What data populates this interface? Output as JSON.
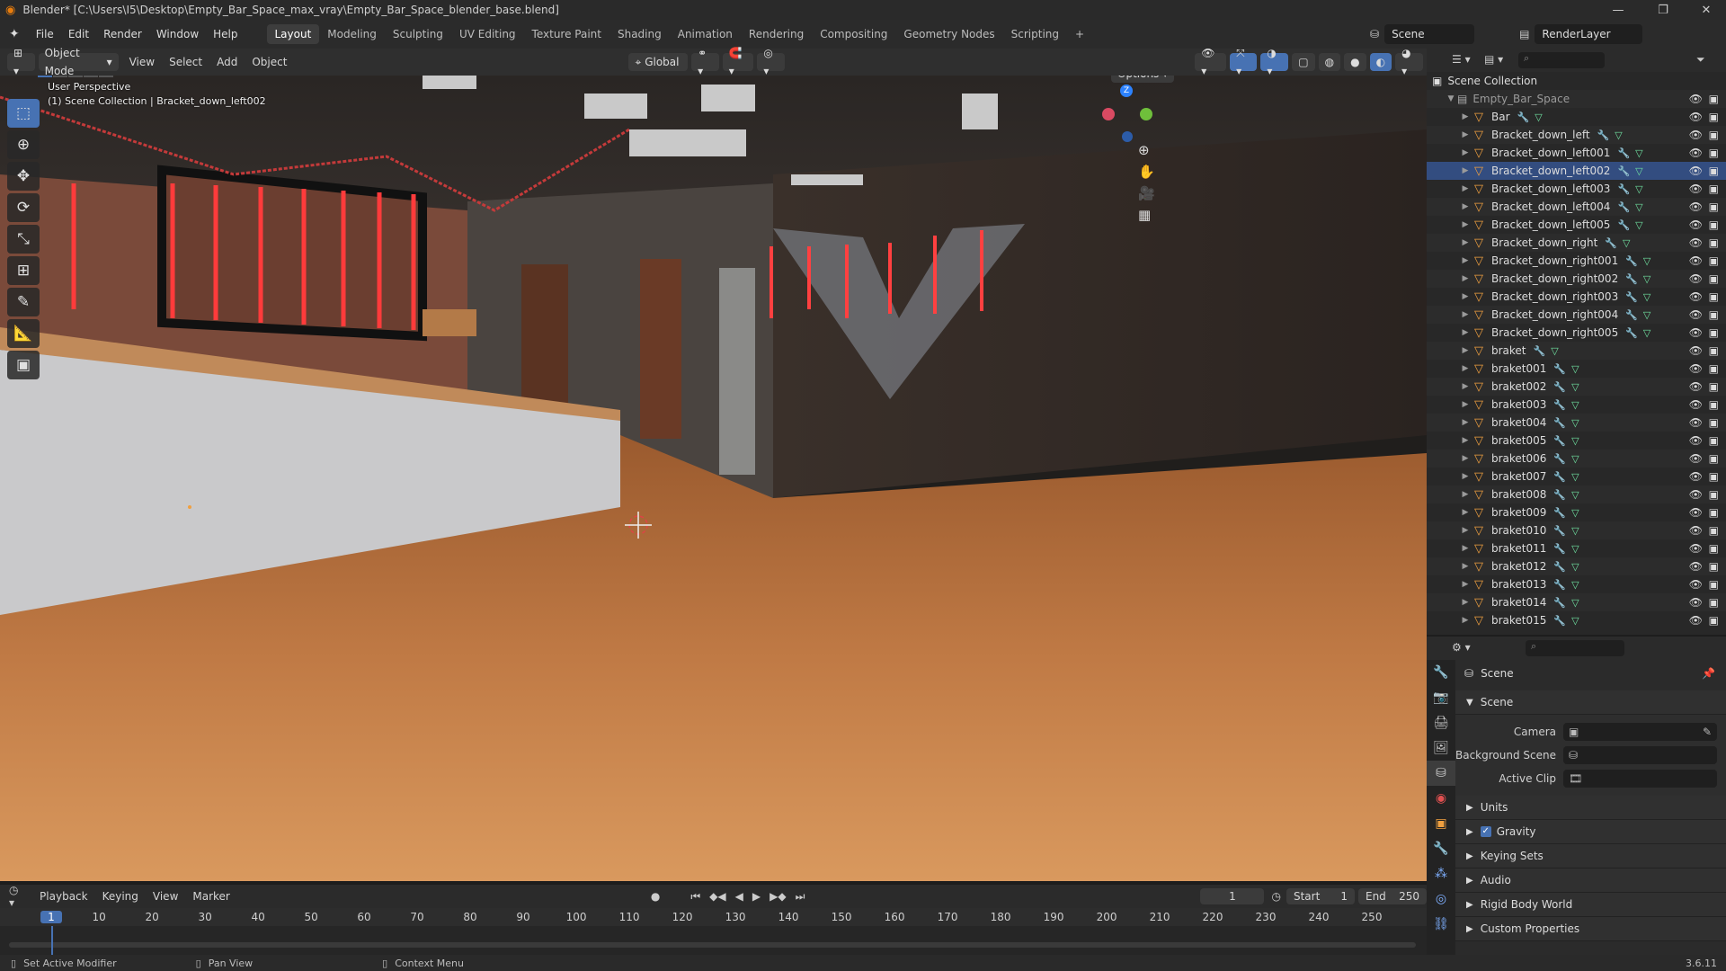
{
  "window": {
    "title": "Blender* [C:\\Users\\I5\\Desktop\\Empty_Bar_Space_max_vray\\Empty_Bar_Space_blender_base.blend]"
  },
  "menus": [
    "File",
    "Edit",
    "Render",
    "Window",
    "Help"
  ],
  "workspaces": [
    "Layout",
    "Modeling",
    "Sculpting",
    "UV Editing",
    "Texture Paint",
    "Shading",
    "Animation",
    "Rendering",
    "Compositing",
    "Geometry Nodes",
    "Scripting"
  ],
  "scene_field": "Scene",
  "view_layer_field": "RenderLayer",
  "viewport_header": {
    "mode": "Object Mode",
    "items": [
      "View",
      "Select",
      "Add",
      "Object"
    ],
    "orientation": "Global",
    "options_label": "Options"
  },
  "viewport": {
    "perspective": "User Perspective",
    "collection_info": "(1) Scene Collection | Bracket_down_left002",
    "axis_z": "Z"
  },
  "outliner": {
    "root": "Scene Collection",
    "collection": "Empty_Bar_Space",
    "items": [
      "Bar",
      "Bracket_down_left",
      "Bracket_down_left001",
      "Bracket_down_left002",
      "Bracket_down_left003",
      "Bracket_down_left004",
      "Bracket_down_left005",
      "Bracket_down_right",
      "Bracket_down_right001",
      "Bracket_down_right002",
      "Bracket_down_right003",
      "Bracket_down_right004",
      "Bracket_down_right005",
      "braket",
      "braket001",
      "braket002",
      "braket003",
      "braket004",
      "braket005",
      "braket006",
      "braket007",
      "braket008",
      "braket009",
      "braket010",
      "braket011",
      "braket012",
      "braket013",
      "braket014",
      "braket015"
    ]
  },
  "properties": {
    "context": "Scene",
    "section": "Scene",
    "camera_label": "Camera",
    "background_label": "Background Scene",
    "clip_label": "Active Clip",
    "panels": [
      "Units",
      "Gravity",
      "Keying Sets",
      "Audio",
      "Rigid Body World",
      "Custom Properties"
    ]
  },
  "timeline": {
    "menus": [
      "Playback",
      "Keying",
      "View",
      "Marker"
    ],
    "current_frame": "1",
    "start_label": "Start",
    "start": "1",
    "end_label": "End",
    "end": "250",
    "ticks": [
      "1",
      "10",
      "20",
      "30",
      "40",
      "50",
      "60",
      "70",
      "80",
      "90",
      "100",
      "110",
      "120",
      "130",
      "140",
      "150",
      "160",
      "170",
      "180",
      "190",
      "200",
      "210",
      "220",
      "230",
      "240",
      "250"
    ]
  },
  "status": {
    "left": "Set Active Modifier",
    "mid": "Pan View",
    "right": "Context Menu",
    "version": "3.6.11"
  }
}
